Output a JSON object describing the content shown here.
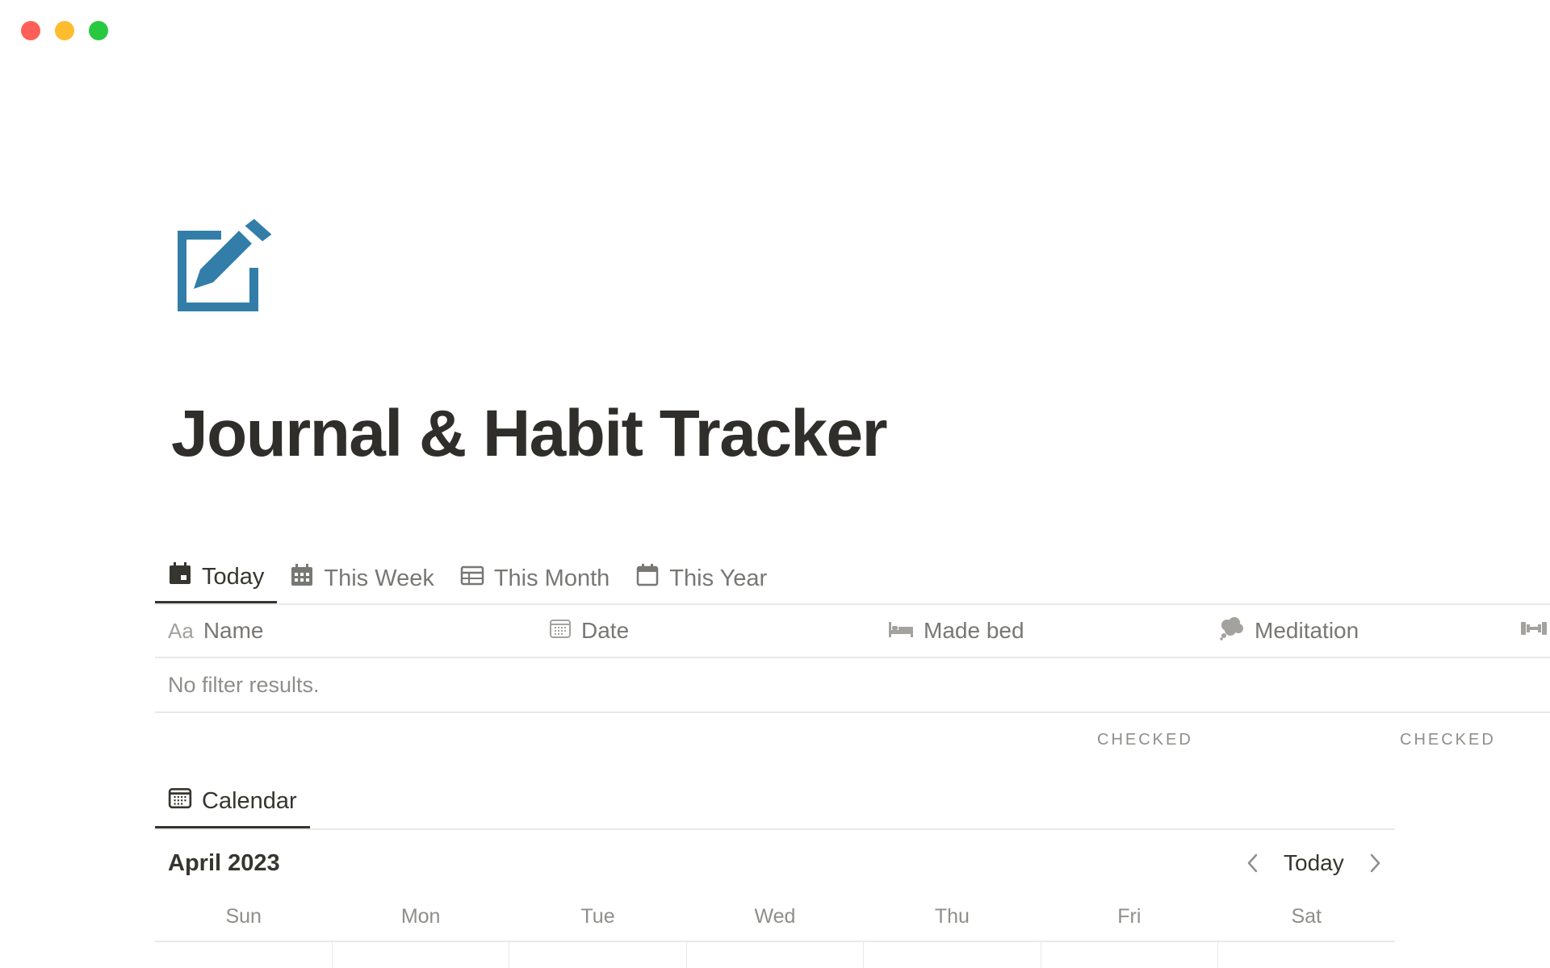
{
  "page": {
    "title": "Journal & Habit Tracker",
    "icon": "pencil-square-icon",
    "icon_color": "#337ea9"
  },
  "views": [
    {
      "label": "Today",
      "icon": "calendar-day-icon",
      "active": true
    },
    {
      "label": "This Week",
      "icon": "calendar-grid-icon",
      "active": false
    },
    {
      "label": "This Month",
      "icon": "table-icon",
      "active": false
    },
    {
      "label": "This Year",
      "icon": "calendar-icon",
      "active": false
    }
  ],
  "table": {
    "columns": [
      {
        "label": "Name",
        "prefix": "Aa",
        "icon": "text-icon"
      },
      {
        "label": "Date",
        "icon": "calendar-icon"
      },
      {
        "label": "Made bed",
        "icon": "bed-icon"
      },
      {
        "label": "Meditation",
        "icon": "thought-cloud-icon"
      },
      {
        "label": "",
        "icon": "dumbbell-icon"
      }
    ],
    "empty_message": "No filter results.",
    "calculations": [
      "CHECKED",
      "CHECKED"
    ]
  },
  "calendar": {
    "tab_label": "Calendar",
    "tab_icon": "calendar-icon",
    "month": "April 2023",
    "today_label": "Today",
    "weekdays": [
      "Sun",
      "Mon",
      "Tue",
      "Wed",
      "Thu",
      "Fri",
      "Sat"
    ]
  },
  "colors": {
    "text": "#37352f",
    "muted": "#787774",
    "divider": "#e9e9e7",
    "accent": "#337ea9"
  }
}
